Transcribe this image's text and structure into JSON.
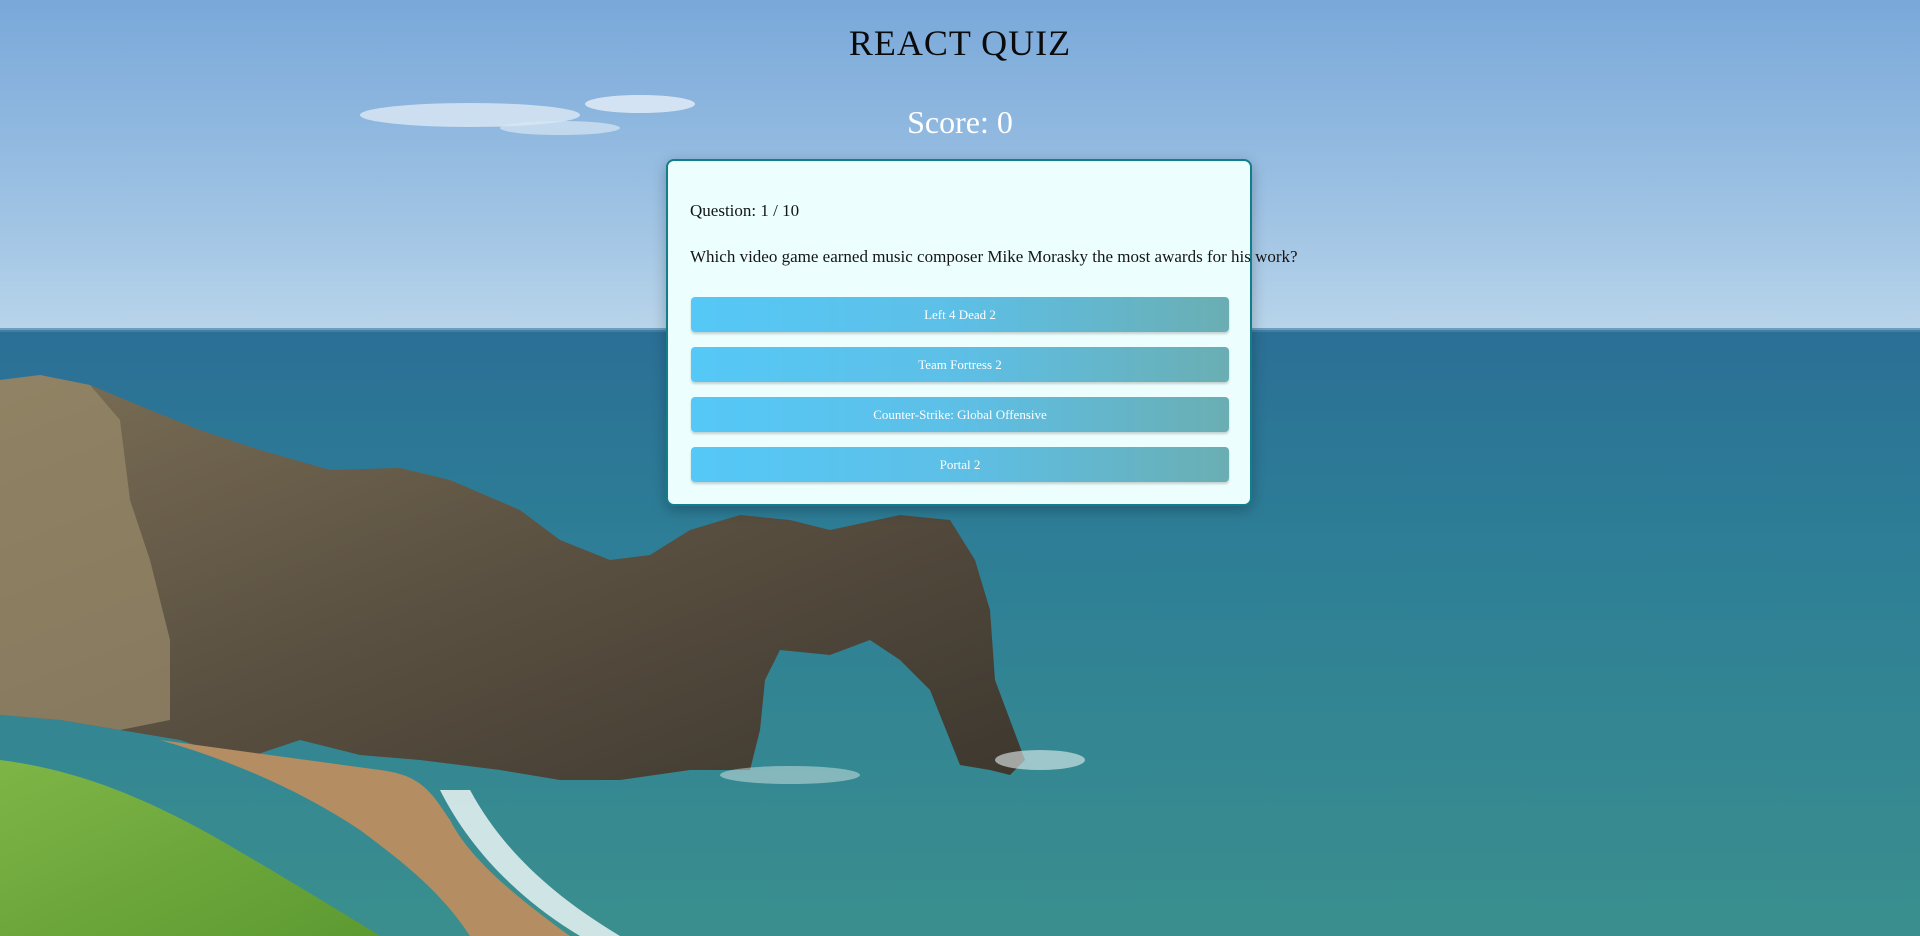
{
  "header": {
    "title": "REACT QUIZ",
    "score_text": "Score: 0"
  },
  "quiz": {
    "question_counter": "Question: 1 / 10",
    "question_text": "Which video game earned music composer Mike Morasky the most awards for his work?",
    "answers": [
      "Left 4 Dead 2",
      "Team Fortress 2",
      "Counter-Strike: Global Offensive",
      "Portal 2"
    ]
  },
  "colors": {
    "title_text": "#0b0b0b",
    "score_text": "#ffffff",
    "card_background": "#ecfefe",
    "card_border": "#127e8a",
    "answer_gradient_start": "#55c8f7",
    "answer_gradient_end": "#6aaeb3"
  }
}
